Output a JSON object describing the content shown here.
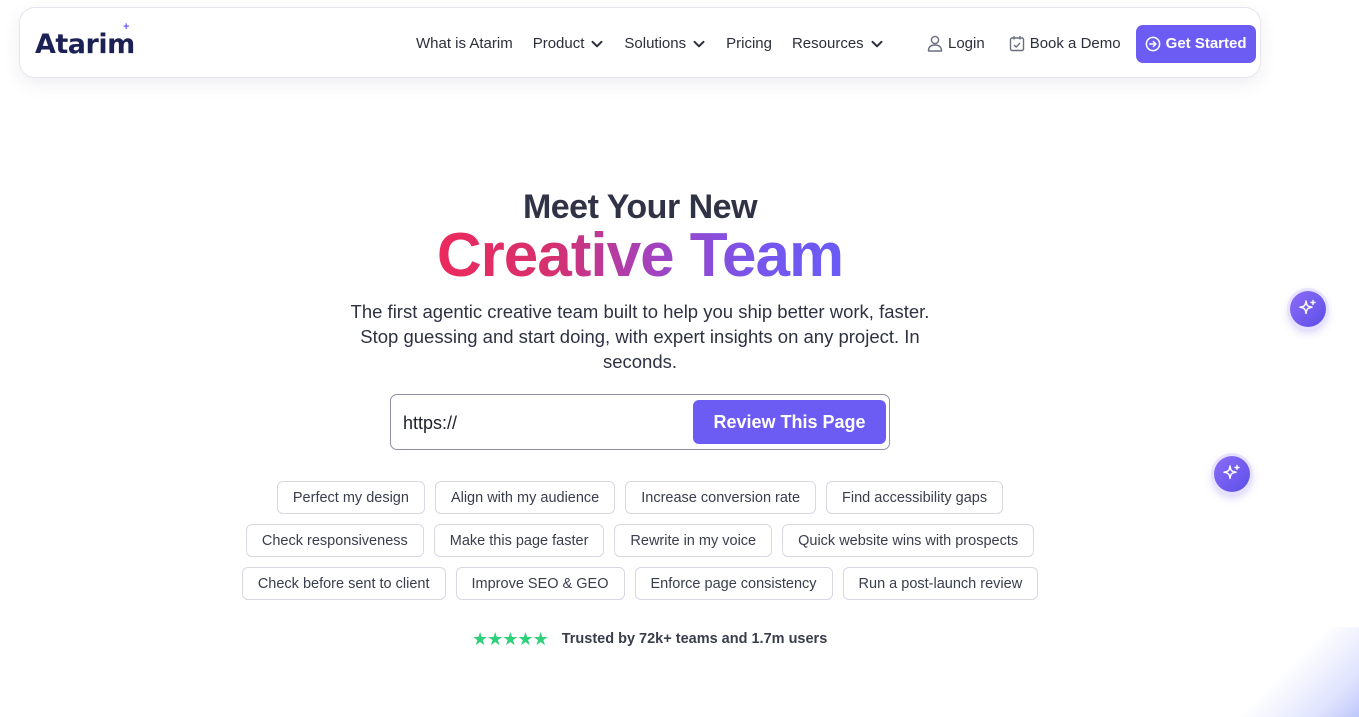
{
  "brand": {
    "name": "Atarim",
    "accent": "#6c5cf4",
    "logo_spark": "+"
  },
  "nav": {
    "links": [
      {
        "label": "What is Atarim",
        "has_dropdown": false
      },
      {
        "label": "Product",
        "has_dropdown": true
      },
      {
        "label": "Solutions",
        "has_dropdown": true
      },
      {
        "label": "Pricing",
        "has_dropdown": false
      },
      {
        "label": "Resources",
        "has_dropdown": true
      }
    ],
    "login_label": "Login",
    "login_icon": "user-icon",
    "demo_label": "Book a Demo",
    "demo_icon": "calendar-check-icon",
    "cta_label": "Get Started",
    "cta_icon": "arrow-circle-right-icon"
  },
  "hero": {
    "line1": "Meet Your New",
    "line2": "Creative Team",
    "gradient": [
      "#ec2a5c",
      "#9f44c4",
      "#6a5bf6"
    ],
    "subtitle": "The first agentic creative team built to help you ship better work, faster. Stop guessing and start doing, with expert insights on any project. In seconds."
  },
  "url_form": {
    "value": "https://",
    "button_label": "Review This Page"
  },
  "chips": {
    "row1": [
      "Perfect my design",
      "Align with my audience",
      "Increase conversion rate",
      "Find accessibility gaps"
    ],
    "row2": [
      "Check responsiveness",
      "Make this page faster",
      "Rewrite in my voice",
      "Quick website wins with prospects"
    ],
    "row3": [
      "Check before sent to client",
      "Improve SEO & GEO",
      "Enforce page consistency",
      "Run a post-launch review"
    ]
  },
  "trust": {
    "rating_stars": 5,
    "star_color": "#2fd07a",
    "text": "Trusted by 72k+ teams and 1.7m users"
  },
  "floating": {
    "icon": "sparkle-icon"
  }
}
